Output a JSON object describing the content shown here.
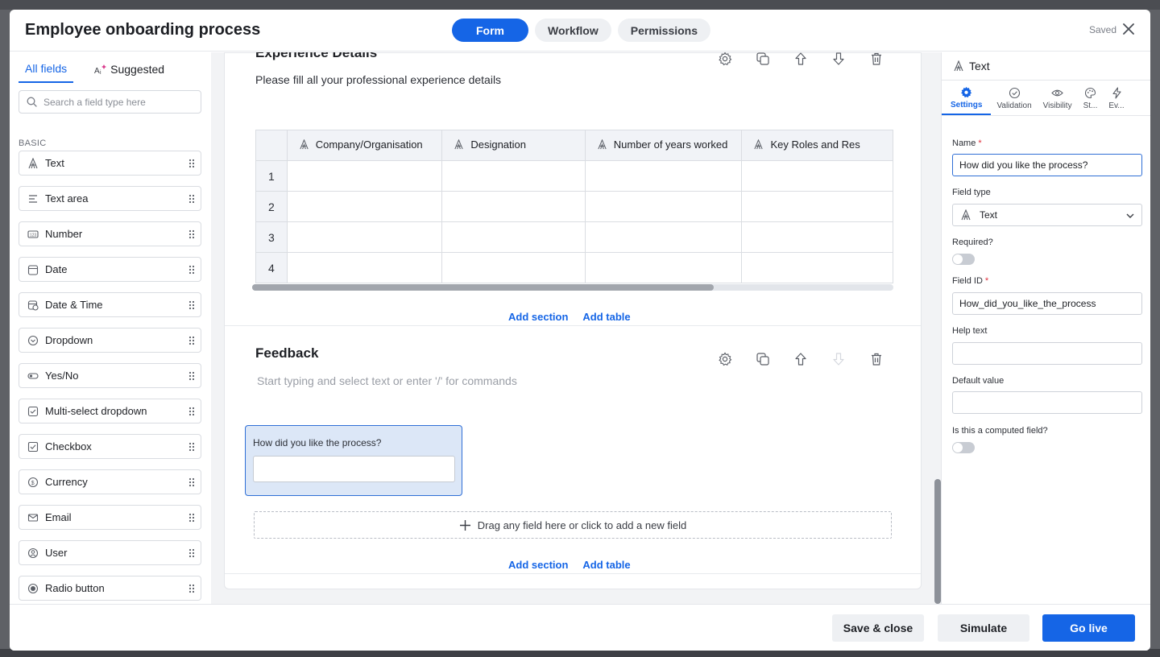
{
  "header": {
    "title": "Employee onboarding process",
    "tabs": [
      {
        "label": "Form",
        "active": true
      },
      {
        "label": "Workflow",
        "active": false
      },
      {
        "label": "Permissions",
        "active": false
      }
    ],
    "status": "Saved"
  },
  "left": {
    "tabs": {
      "all_fields": "All fields",
      "suggested": "Suggested"
    },
    "search_placeholder": "Search a field type here",
    "group_label": "BASIC",
    "fields": [
      {
        "label": "Text",
        "icon": "text-icon"
      },
      {
        "label": "Text area",
        "icon": "text-area-icon"
      },
      {
        "label": "Number",
        "icon": "number-icon"
      },
      {
        "label": "Date",
        "icon": "date-icon"
      },
      {
        "label": "Date & Time",
        "icon": "date-time-icon"
      },
      {
        "label": "Dropdown",
        "icon": "dropdown-icon"
      },
      {
        "label": "Yes/No",
        "icon": "toggle-icon"
      },
      {
        "label": "Multi-select dropdown",
        "icon": "multi-select-icon"
      },
      {
        "label": "Checkbox",
        "icon": "checkbox-icon"
      },
      {
        "label": "Currency",
        "icon": "currency-icon"
      },
      {
        "label": "Email",
        "icon": "email-icon"
      },
      {
        "label": "User",
        "icon": "user-icon"
      },
      {
        "label": "Radio button",
        "icon": "radio-icon"
      }
    ]
  },
  "canvas": {
    "experience": {
      "title": "Experience Details",
      "description": "Please fill all your professional experience details",
      "table": {
        "columns": [
          "Company/Organisation",
          "Designation",
          "Number of years worked",
          "Key Roles and Res"
        ],
        "rows": [
          "1",
          "2",
          "3",
          "4"
        ]
      },
      "scroll_fraction": 0.72
    },
    "add_section": "Add section",
    "add_table": "Add table",
    "feedback": {
      "title": "Feedback",
      "placeholder": "Start typing and select text or enter '/' for commands",
      "field_label": "How did you like the process?",
      "dropzone": "Drag any field here or click to add a new field"
    }
  },
  "props": {
    "header": "Text",
    "tabs": [
      {
        "label": "Settings",
        "icon": "gear-icon",
        "active": true
      },
      {
        "label": "Validation",
        "icon": "check-circle-icon",
        "active": false
      },
      {
        "label": "Visibility",
        "icon": "eye-icon",
        "active": false
      },
      {
        "label": "St...",
        "icon": "palette-icon",
        "active": false
      },
      {
        "label": "Ev...",
        "icon": "bolt-icon",
        "active": false
      }
    ],
    "name_label": "Name",
    "name_value": "How did you like the process?",
    "field_type_label": "Field type",
    "field_type_value": "Text",
    "required_label": "Required?",
    "required": false,
    "field_id_label": "Field ID",
    "field_id_value": "How_did_you_like_the_process",
    "help_text_label": "Help text",
    "help_text_value": "",
    "default_value_label": "Default value",
    "default_value": "",
    "computed_label": "Is this a computed field?",
    "computed": false
  },
  "footer": {
    "save_close": "Save & close",
    "simulate": "Simulate",
    "go_live": "Go live"
  },
  "colors": {
    "accent": "#1565e6",
    "selected_bg": "#dce7f7",
    "required": "#e0303c"
  }
}
